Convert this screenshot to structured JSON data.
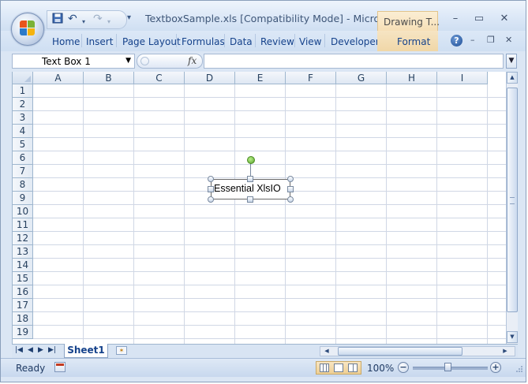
{
  "window": {
    "title": "TextboxSample.xls  [Compatibility Mode] - Microso...",
    "context_tab": "Drawing T...",
    "controls": {
      "minimize": "–",
      "maximize": "▭",
      "close": "✕"
    }
  },
  "ribbon": {
    "tabs": [
      "Home",
      "Insert",
      "Page Layout",
      "Formulas",
      "Data",
      "Review",
      "View",
      "Developer"
    ],
    "context_format_tab": "Format",
    "help": "?",
    "mini_controls": {
      "minimize": "–",
      "restore": "❐",
      "close": "✕"
    }
  },
  "formula_bar": {
    "name_box": "Text Box 1",
    "fx_label": "fx",
    "formula": ""
  },
  "sheet": {
    "columns": [
      "A",
      "B",
      "C",
      "D",
      "E",
      "F",
      "G",
      "H",
      "I"
    ],
    "rows": [
      "1",
      "2",
      "3",
      "4",
      "5",
      "6",
      "7",
      "8",
      "9",
      "10",
      "11",
      "12",
      "13",
      "14",
      "15",
      "16",
      "17",
      "18",
      "19"
    ],
    "textbox_text": "Essential XlsIO"
  },
  "sheet_tabs": {
    "tabs": [
      "Sheet1"
    ],
    "active": "Sheet1"
  },
  "status_bar": {
    "state": "Ready",
    "zoom": "100%",
    "zoom_out": "−",
    "zoom_in": "+"
  },
  "icons": [
    "office-button-icon",
    "save-icon",
    "undo-icon",
    "redo-icon",
    "customize-qat-icon",
    "help-icon",
    "fx-icon",
    "insert-sheet-icon",
    "macro-record-icon",
    "normal-view-icon",
    "page-layout-view-icon",
    "page-break-view-icon"
  ],
  "colors": {
    "accent": "#15428b",
    "context_tab": "#f6dfb6",
    "rotation_handle": "#58a22c"
  }
}
